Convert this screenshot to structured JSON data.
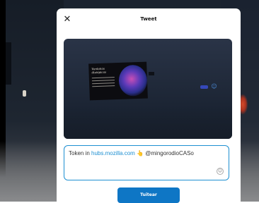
{
  "modal": {
    "title": "Tweet",
    "close_icon": "close-icon",
    "close_glyph": "✕"
  },
  "preview": {
    "poster_title": "Ventanas distópicas",
    "badge_icon": "person-icon",
    "badge_glyph": "☺"
  },
  "compose": {
    "prefix": "Token in ",
    "link": "hubs.mozilla.com",
    "hand_emoji": "👆",
    "mention": " @mingorodioCASo",
    "emoji_button_icon": "smiley-icon",
    "emoji_button_glyph": "☺"
  },
  "submit": {
    "label": "Tuitear"
  },
  "colors": {
    "accent": "#0e76c5",
    "border_focus": "#1d8fd1"
  }
}
